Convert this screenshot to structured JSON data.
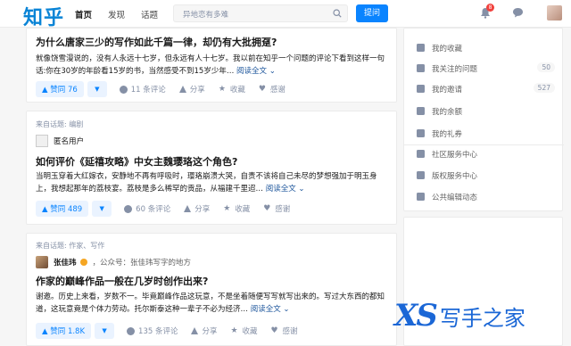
{
  "header": {
    "logo": "知乎",
    "nav": [
      "首页",
      "发现",
      "话题"
    ],
    "search_placeholder": "异地恋有多难",
    "ask_label": "提问",
    "notification_count": "8"
  },
  "feed": [
    {
      "title": "为什么唐家三少的写作如此千篇一律，却仍有大批拥趸?",
      "excerpt": "就像饶雪漫说的，没有人永远十七岁，但永远有人十七岁。我以前在知乎一个问题的评论下看到这样一句话:你在30岁的年龄看15岁的书，当然感受不到15岁少年…",
      "read_more": "阅读全文 ⌄",
      "vote": "▲ 赞同 76",
      "comments": "11 条评论",
      "share": "分享",
      "collect": "收藏",
      "thanks": "感谢"
    },
    {
      "from": "来自话题: 编剧",
      "author": "匿名用户",
      "title": "如何评价《延禧攻略》中女主魏璎珞这个角色?",
      "excerpt": "当明玉穿着大红嫁衣，安静地不再有呼吸时，璎珞崩溃大哭，自责不该将自己未尽的梦想强加于明玉身上，我想起那年的荔枝宴。荔枝是多么稀罕的贡品，从福建千里迢…",
      "read_more": "阅读全文 ⌄",
      "vote": "▲ 赞同 489",
      "comments": "60 条评论",
      "share": "分享",
      "collect": "收藏",
      "thanks": "感谢"
    },
    {
      "from": "来自话题: 作家、写作",
      "author": "张佳玮",
      "author_sub": "，公众号：张佳玮写字的地方",
      "title": "作家的巅峰作品一般在几岁时创作出来?",
      "excerpt": "谢邀。历史上来看，岁数不一。毕竟巅峰作品这玩意，不是坐着随便写写就写出来的。写过大东西的都知道，这玩意竟是个体力劳动。托尔斯泰这种一辈子不必为经济…",
      "read_more": "阅读全文 ⌄",
      "vote": "▲ 赞同 1.8K",
      "comments": "135 条评论",
      "share": "分享",
      "collect": "收藏",
      "thanks": "感谢"
    }
  ],
  "sidebar": {
    "items": [
      {
        "label": "我的收藏",
        "count": ""
      },
      {
        "label": "我关注的问题",
        "count": "50"
      },
      {
        "label": "我的邀请",
        "count": "527"
      },
      {
        "label": "我的余额",
        "count": ""
      },
      {
        "label": "我的礼券",
        "count": ""
      },
      {
        "label": "社区服务中心",
        "count": ""
      },
      {
        "label": "版权服务中心",
        "count": ""
      },
      {
        "label": "公共编辑动态",
        "count": ""
      }
    ]
  },
  "watermark": {
    "xs": "XS",
    "text": "写手之家"
  },
  "colors": {
    "brand": "#0a84ff",
    "link": "#175199",
    "muted": "#8590a6"
  }
}
